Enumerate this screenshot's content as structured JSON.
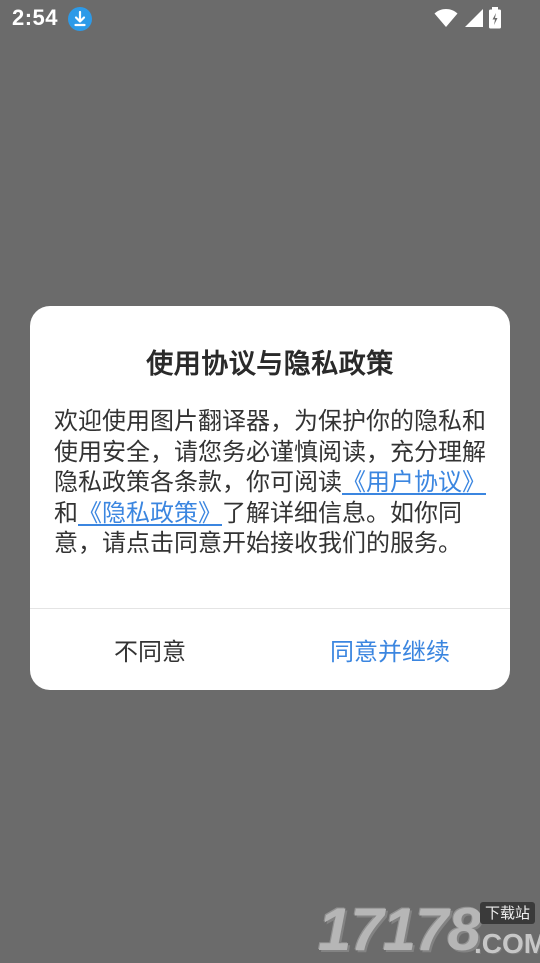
{
  "status_bar": {
    "time": "2:54",
    "icons": [
      "download-icon",
      "wifi-icon",
      "signal-icon",
      "battery-charging-icon"
    ]
  },
  "dialog": {
    "title": "使用协议与隐私政策",
    "body": {
      "text_1": "欢迎使用图片翻译器，为保护你的隐私和使用安全，请您务必谨慎阅读，充分理解隐私政策各条款，你可阅读",
      "link_user_agreement": "《用户协议》",
      "text_2": "和",
      "link_privacy_policy": "《隐私政策》",
      "text_3": "了解详细信息。如你同意，请点击同意开始接收我们的服务。"
    },
    "disagree_label": "不同意",
    "agree_label": "同意并继续"
  },
  "watermark": {
    "digits": "17178",
    "badge": "下载站",
    "domain": ".COM"
  },
  "colors": {
    "overlay": "#6b6b6b",
    "dialog_bg": "#ffffff",
    "accent": "#3b86e0",
    "text": "#333333",
    "download_badge": "#2d9ae8"
  }
}
